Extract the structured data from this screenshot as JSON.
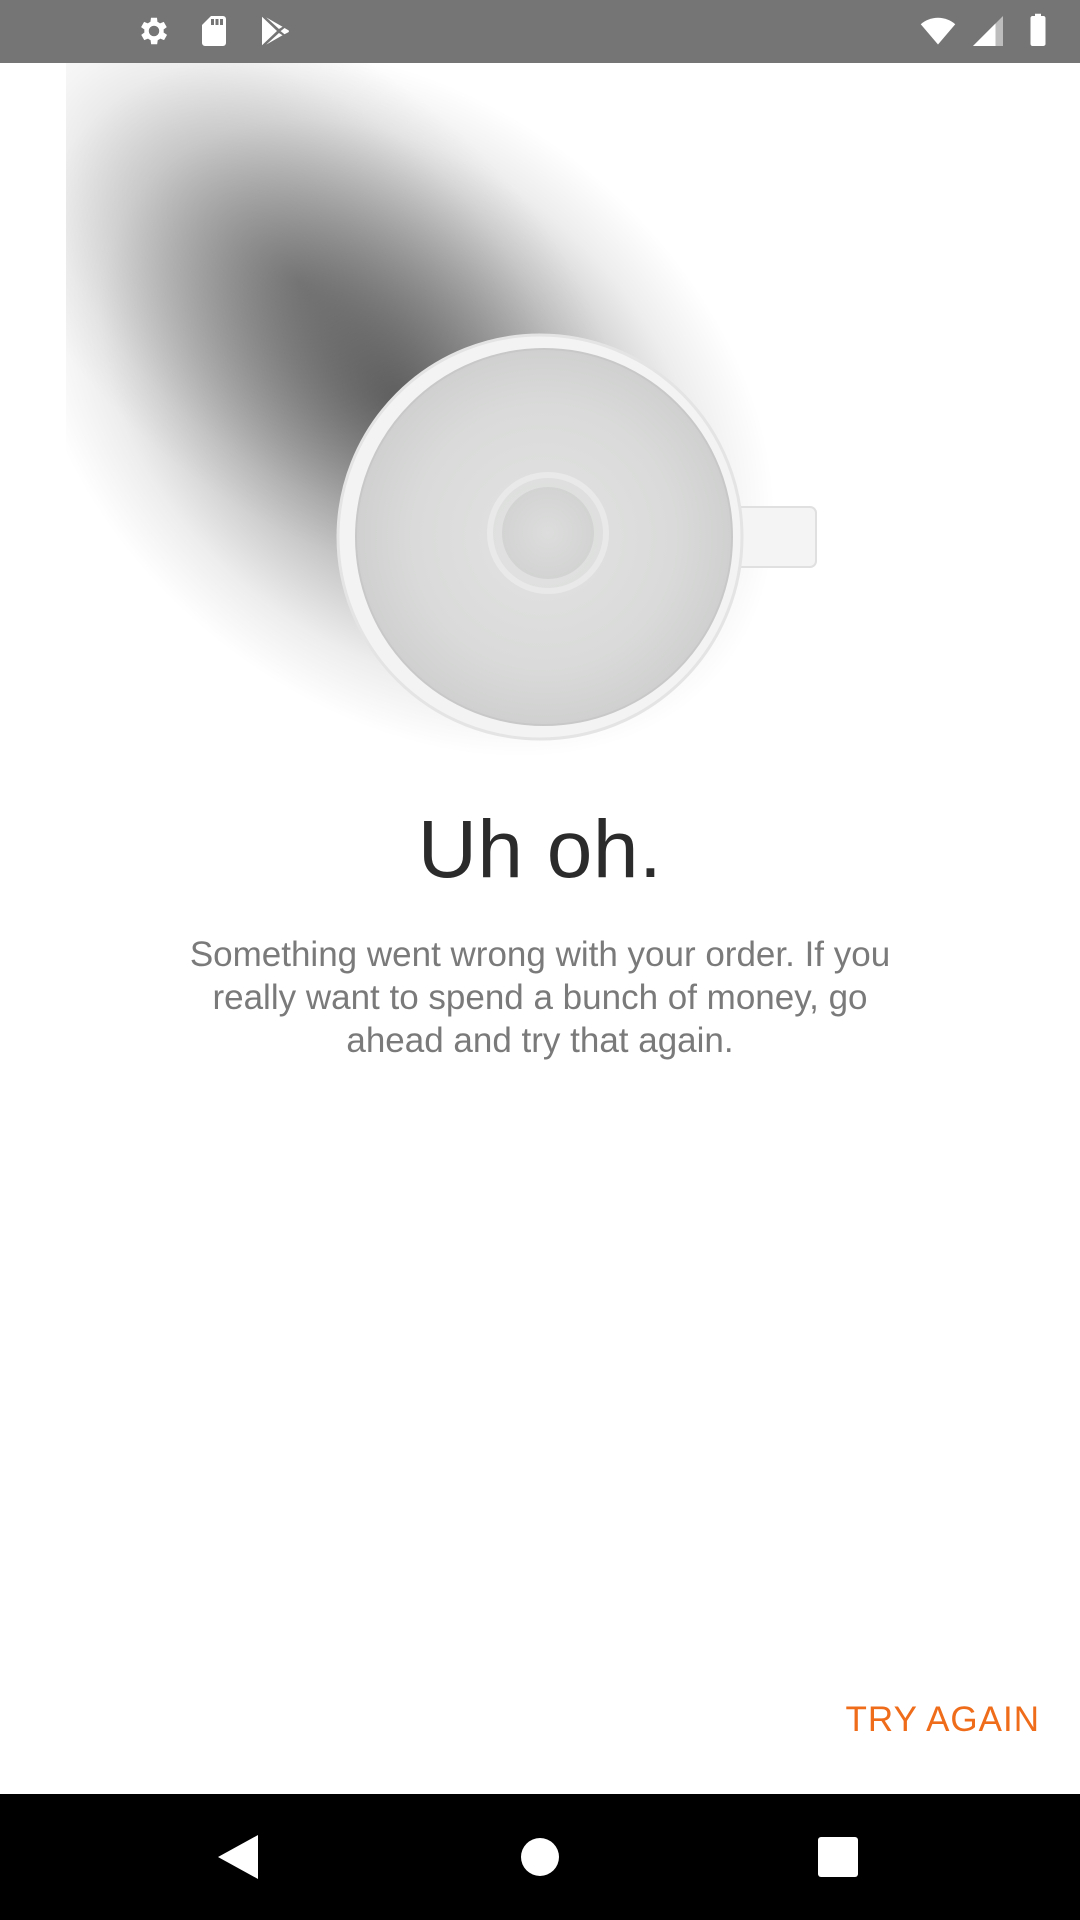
{
  "status_bar": {
    "left_icons": [
      "settings-icon",
      "sd-card-icon",
      "play-store-icon"
    ],
    "right_icons": [
      "wifi-icon",
      "cell-signal-icon",
      "battery-icon"
    ],
    "background": "#757575"
  },
  "main": {
    "title": "Uh oh.",
    "message": "Something went wrong with your order. If you really want to spend a bunch of money, go ahead and try that again.",
    "illustration": "empty-cup-illustration"
  },
  "actions": {
    "try_again_label": "TRY AGAIN",
    "accent_color": "#ef6c1a"
  },
  "nav_bar": {
    "buttons": [
      "back-icon",
      "home-icon",
      "recents-icon"
    ]
  }
}
